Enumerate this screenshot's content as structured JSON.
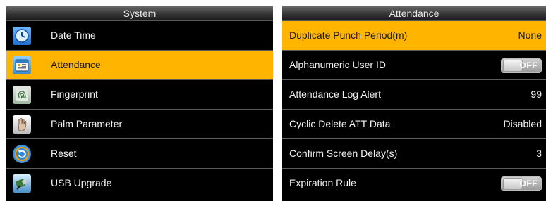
{
  "system_menu": {
    "title": "System",
    "items": [
      {
        "label": "Date Time",
        "icon": "clock-icon"
      },
      {
        "label": "Attendance",
        "icon": "attendance-icon",
        "selected": true
      },
      {
        "label": "Fingerprint",
        "icon": "fingerprint-icon"
      },
      {
        "label": "Palm Parameter",
        "icon": "palm-icon"
      },
      {
        "label": "Reset",
        "icon": "reset-icon"
      },
      {
        "label": "USB Upgrade",
        "icon": "usb-upgrade-icon"
      }
    ]
  },
  "attendance_menu": {
    "title": "Attendance",
    "items": [
      {
        "label": "Duplicate Punch Period(m)",
        "value": "None",
        "selected": true
      },
      {
        "label": "Alphanumeric User ID",
        "toggle": "OFF"
      },
      {
        "label": "Attendance Log Alert",
        "value": "99"
      },
      {
        "label": "Cyclic Delete ATT Data",
        "value": "Disabled"
      },
      {
        "label": "Confirm Screen Delay(s)",
        "value": "3"
      },
      {
        "label": "Expiration Rule",
        "toggle": "OFF"
      }
    ]
  },
  "colors": {
    "selected_row": "#ffb400",
    "panel_background": "#000000",
    "divider": "#5a5a5a"
  }
}
